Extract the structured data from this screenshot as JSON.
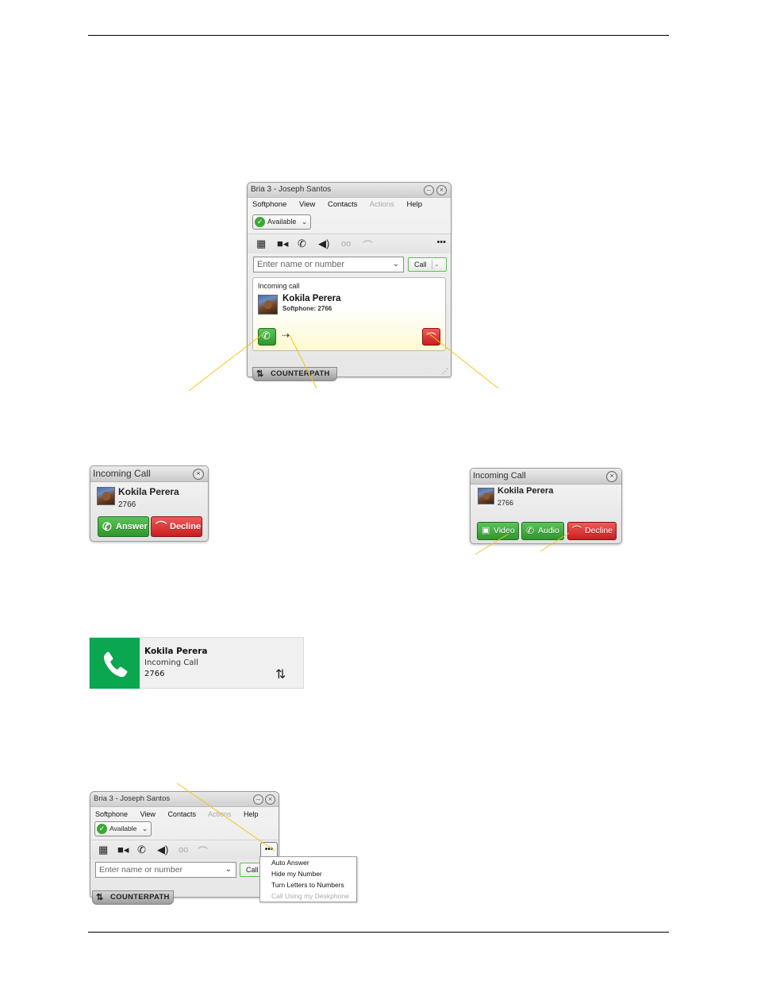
{
  "page": {
    "colors": {
      "callout": "#f5c518",
      "answer_green": "#3a9e35",
      "decline_red": "#d42a2a",
      "toast_green": "#0aa650"
    }
  },
  "bria_main": {
    "title": "Bria 3 - Joseph Santos",
    "minimize_icon": "minimize-icon",
    "close_icon": "close-icon",
    "menu": [
      "Softphone",
      "View",
      "Contacts",
      "Actions",
      "Help"
    ],
    "menu_disabled": [
      "Actions"
    ],
    "presence": "Available",
    "toolbar_icons": [
      "dialpad-icon",
      "video-icon",
      "call-history-icon",
      "speaker-icon",
      "voicemail-icon",
      "hangup-icon",
      "more-icon"
    ],
    "dial_placeholder": "Enter name or number",
    "call_button": "Call",
    "incoming": {
      "heading": "Incoming call",
      "caller_name": "Kokila Perera",
      "caller_detail": "Softphone: 2766"
    },
    "brand": "CounterPath"
  },
  "popup_audio": {
    "title": "Incoming Call",
    "caller_name": "Kokila Perera",
    "caller_number": "2766",
    "answer": "Answer",
    "decline": "Decline"
  },
  "popup_video": {
    "title": "Incoming Call",
    "caller_name": "Kokila Perera",
    "caller_number": "2766",
    "video": "Video",
    "audio": "Audio",
    "decline": "Decline"
  },
  "toast": {
    "caller_name": "Kokila Perera",
    "status": "Incoming Call",
    "number": "2766"
  },
  "bria_menu_example": {
    "title": "Bria 3 - Joseph Santos",
    "menu": [
      "Softphone",
      "View",
      "Contacts",
      "Actions",
      "Help"
    ],
    "presence": "Available",
    "dial_placeholder": "Enter name or number",
    "call_button": "Call",
    "brand": "CounterPath",
    "more_menu": [
      {
        "label": "Auto Answer",
        "enabled": true
      },
      {
        "label": "Hide my Number",
        "enabled": true
      },
      {
        "label": "Turn Letters to Numbers",
        "enabled": true
      },
      {
        "label": "Call Using my Deskphone",
        "enabled": false
      }
    ]
  }
}
